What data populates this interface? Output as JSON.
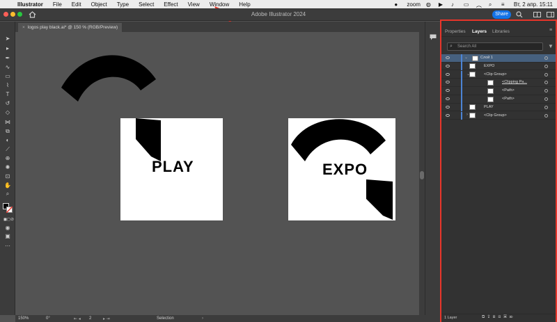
{
  "menubar": {
    "app_name": "Illustrator",
    "items": [
      "File",
      "Edit",
      "Object",
      "Type",
      "Select",
      "Effect",
      "View",
      "Window",
      "Help"
    ],
    "zoom_label": "zoom",
    "datetime": "Вт, 2 апр.  15:11"
  },
  "appbar": {
    "title": "Adobe Illustrator 2024",
    "share_label": "Share"
  },
  "document_tab": {
    "label": "logos play black.ai* @ 150 % (RGB/Preview)"
  },
  "artboards": {
    "left_label": "PLAY",
    "right_label": "EXPO"
  },
  "panel": {
    "tabs": [
      "Properties",
      "Layers",
      "Libraries"
    ],
    "active_tab": "Layers",
    "search_placeholder": "Search All",
    "rows": [
      "Слой 1",
      "EXPO",
      "<Clip Group>",
      "<Clipping Pa...",
      "<Path>",
      "<Path>",
      "PLAY",
      "<Clip Group>"
    ],
    "footer_count": "1 Layer"
  },
  "statusbar": {
    "zoom": "150%",
    "rotation": "0°",
    "artboard_num": "2",
    "mode": "Selection"
  },
  "colors": {
    "accent": "#1473e6",
    "highlight_border": "#e8352a",
    "annotation_arrow": "#e8352a",
    "layer_bar": "#4c84d6"
  }
}
